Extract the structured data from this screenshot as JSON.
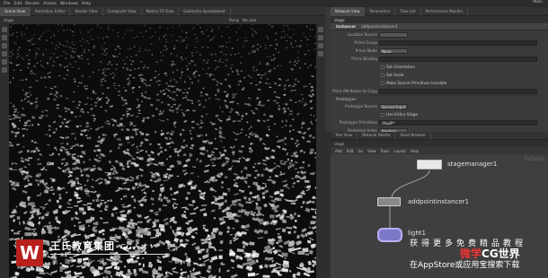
{
  "menu": {
    "items": [
      "File",
      "Edit",
      "Render",
      "Assets",
      "Windows",
      "Help"
    ],
    "build": "Main"
  },
  "tabs_left": [
    "Scene View",
    "Animation Editor",
    "Render View",
    "Composite View",
    "Motion FX View",
    "Geometry Spreadsheet"
  ],
  "tabs_right": [
    "Network View",
    "Parameters",
    "Take List",
    "Performance Monitor"
  ],
  "viewport": {
    "path": "stage",
    "labels": [
      "Persp",
      "No cam"
    ]
  },
  "params": {
    "path": "stage",
    "node_type": "Instancer",
    "node_name": "addpointinstancer1",
    "rows": [
      {
        "label": "Location Source",
        "value": "",
        "kind": "field"
      },
      {
        "label": "Prims Group",
        "value": "",
        "kind": "field"
      },
      {
        "label": "Prims Mode",
        "value": "None",
        "kind": "select"
      },
      {
        "label": "Prims Binding",
        "value": "",
        "kind": "field"
      }
    ],
    "checks": [
      "Set Orientation",
      "Set Scale",
      "Make Source Primitives Invisible"
    ],
    "row_after_checks": {
      "label": "Point Attributes to Copy",
      "value": ""
    },
    "section": "Prototypes",
    "proto_rows": [
      {
        "label": "Prototype Source",
        "value": "Second Input",
        "kind": "select"
      },
      {
        "label": "",
        "value": "Use Entire Stage",
        "kind": "check"
      },
      {
        "label": "Prototype Primitives",
        "value": "/ReplP*",
        "kind": "field"
      },
      {
        "label": "Prototype Index",
        "value": "Random",
        "kind": "select"
      },
      {
        "label": "Seed",
        "value": "",
        "kind": "slider"
      }
    ]
  },
  "network": {
    "tabs": [
      "Tree View",
      "Material Palette",
      "Asset Browser"
    ],
    "path": "stage",
    "menu": [
      "Add",
      "Edit",
      "Go",
      "View",
      "Tools",
      "Layout",
      "Help"
    ],
    "context": "Solaris",
    "nodes": [
      {
        "name": "stagemanager1"
      },
      {
        "name": "addpointinstancer1"
      },
      {
        "name": "light1"
      }
    ]
  },
  "watermark": {
    "brand": "王氏教育集团",
    "brand_suffix": "CG人才",
    "sub": "高 端 C G 课 程",
    "ad_line1": "获得更多免费精品教程",
    "ad_brand_a": "微学",
    "ad_brand_b": "CG世界",
    "ad_line2": "在AppStore或应用宝搜索下载"
  },
  "colors": {
    "viewport_bg": "#0c0c0c",
    "network_bg": "#3f3f3f",
    "logo": "#b8201c"
  }
}
